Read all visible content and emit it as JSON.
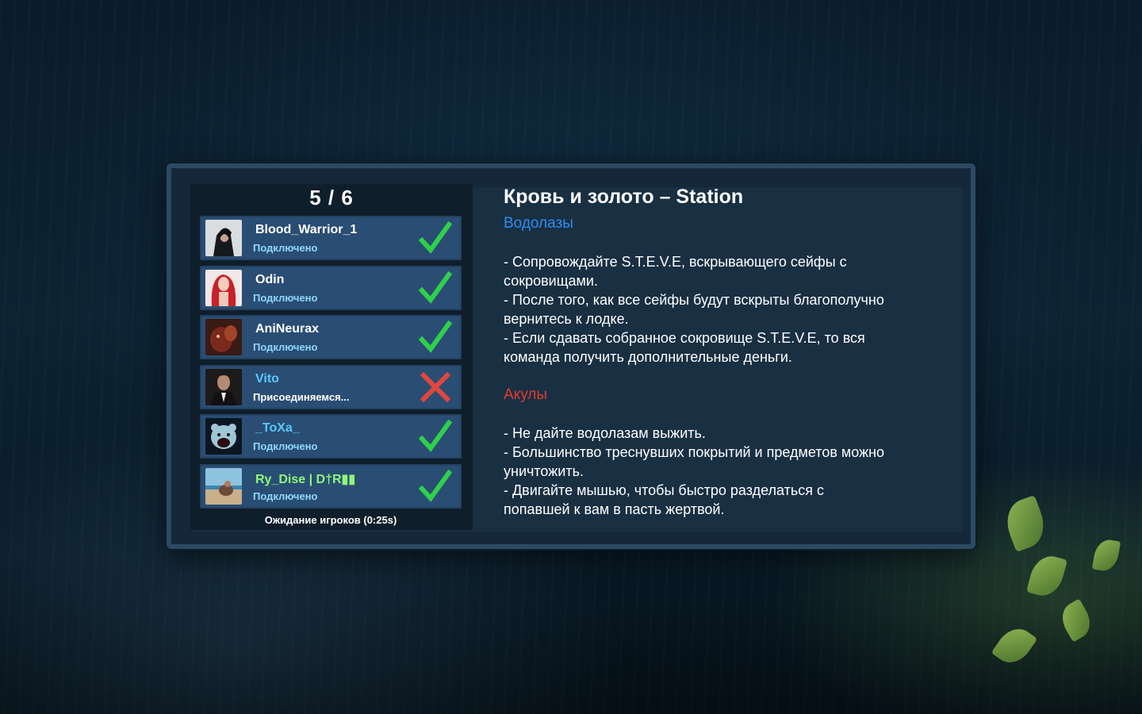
{
  "lobby": {
    "counter": "5 / 6",
    "waiting_text": "Ожидание игроков (0:25s)",
    "players": [
      {
        "name": "Blood_Warrior_1",
        "status": "Подключено",
        "ready": true,
        "name_color": "#ffffff",
        "avatar": "dark-haired-figure"
      },
      {
        "name": "Odin",
        "status": "Подключено",
        "ready": true,
        "name_color": "#ffffff",
        "avatar": "red-haired-girl"
      },
      {
        "name": "AniNeurax",
        "status": "Подключено",
        "ready": true,
        "name_color": "#ffffff",
        "avatar": "dark-red-creature"
      },
      {
        "name": "Vito",
        "status": "Присоединяемся...",
        "ready": false,
        "name_color": "#59c8ff",
        "avatar": "man-in-suit"
      },
      {
        "name": "_ToXa_",
        "status": "Подключено",
        "ready": true,
        "name_color": "#59c8ff",
        "avatar": "roaring-bear"
      },
      {
        "name": "Ry_Dise | D†R▮▮",
        "status": "Подключено",
        "ready": true,
        "name_color": "#8ef77a",
        "avatar": "beach-scene"
      }
    ]
  },
  "map": {
    "title": "Кровь и золото – Station",
    "divers_label": "Водолазы",
    "divers_rules": [
      "- Сопровождайте S.T.E.V.E, вскрывающего сейфы с",
      "сокровищами.",
      "- После того, как все сейфы будут вскрыты благополучно",
      "вернитесь к лодке.",
      "- Если сдавать собранное сокровище S.T.E.V.E, то вся",
      "команда получить дополнительные деньги."
    ],
    "sharks_label": "Акулы",
    "sharks_rules": [
      "- Не дайте водолазам выжить.",
      "- Большинство треснувших покрытий и предметов можно",
      "уничтожить.",
      "- Двигайте мышью, чтобы быстро разделаться с",
      "попавшей к вам в пасть жертвой."
    ]
  },
  "colors": {
    "ready_check": "#2fd04a",
    "not_ready_cross": "#e0473d",
    "row_bg": "#2a4d74",
    "divers": "#2e8df0",
    "sharks": "#e43a30"
  }
}
